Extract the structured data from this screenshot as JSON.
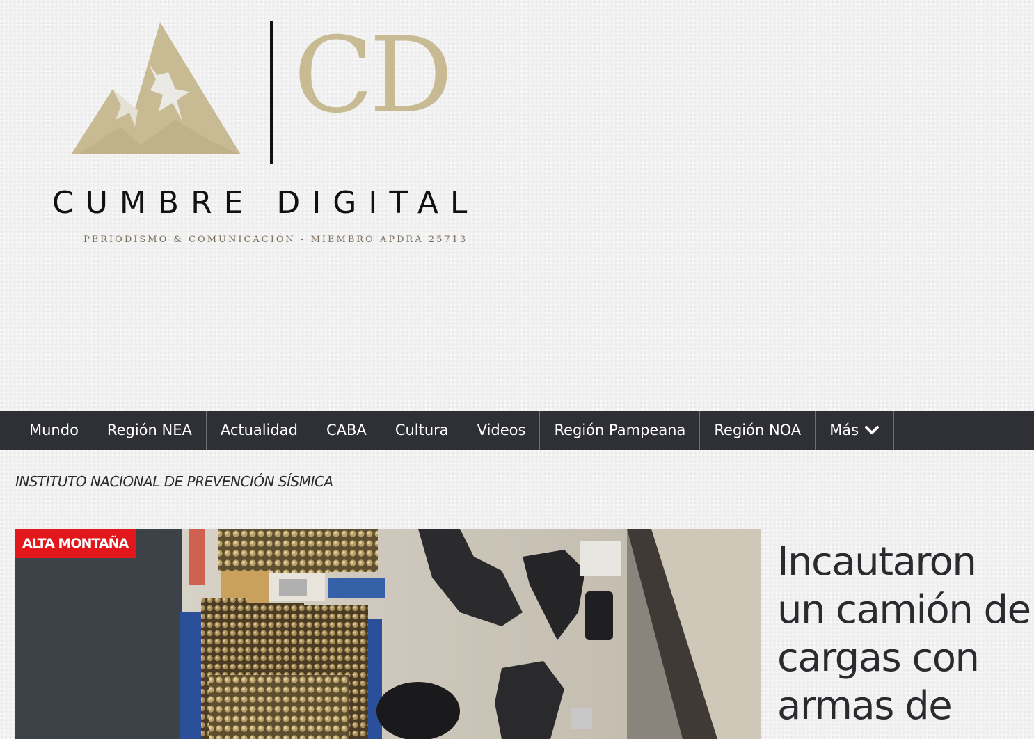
{
  "header": {
    "logo_initials": "CD",
    "site_name": "CUMBRE DIGITAL",
    "tagline": "PERIODISMO & COMUNICACIÓN  - MIEMBRO APDRA 25713",
    "logo_color": "#c8bb93"
  },
  "nav": {
    "items": [
      {
        "label": "Mundo"
      },
      {
        "label": "Región NEA"
      },
      {
        "label": "Actualidad"
      },
      {
        "label": "CABA"
      },
      {
        "label": "Cultura"
      },
      {
        "label": "Videos"
      },
      {
        "label": "Región Pampeana"
      },
      {
        "label": "Región NOA"
      },
      {
        "label": "Más",
        "icon": "chevron-down-icon"
      }
    ],
    "background": "#2f3035"
  },
  "ticker": {
    "text": "INSTITUTO NACIONAL DE PREVENCIÓN SÍSMICA"
  },
  "featured": {
    "category": "ALTA MONTAÑA",
    "category_color": "#e2171c",
    "title": "Incautaron un camión de cargas con armas de"
  }
}
